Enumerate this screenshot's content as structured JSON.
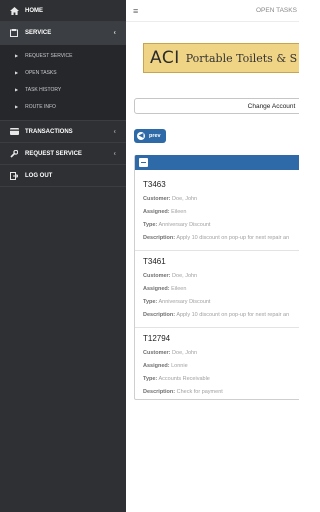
{
  "sidebar": {
    "items": [
      {
        "label": "HOME",
        "icon": "home-icon"
      },
      {
        "label": "SERVICE",
        "icon": "clipboard-icon",
        "active": true
      },
      {
        "label": "TRANSACTIONS",
        "icon": "card-icon"
      },
      {
        "label": "REQUEST SERVICE",
        "icon": "wrench-icon"
      },
      {
        "label": "LOG OUT",
        "icon": "logout-icon"
      }
    ],
    "service_sub": [
      {
        "label": "REQUEST SERVICE"
      },
      {
        "label": "OPEN TASKS"
      },
      {
        "label": "TASK HISTORY"
      },
      {
        "label": "ROUTE INFO"
      }
    ]
  },
  "topbar": {
    "title": "OPEN TASKS"
  },
  "logo": {
    "brand": "ACI",
    "tagline": "Portable Toilets & S"
  },
  "change_account": {
    "label": "Change Account"
  },
  "prev": {
    "label": "prev"
  },
  "field_labels": {
    "customer": "Customer:",
    "assigned": "Assigned:",
    "type": "Type:",
    "description": "Description:"
  },
  "tasks": [
    {
      "id": "T3463",
      "customer": "Doe, John",
      "assigned": "Eileen",
      "type": "Anniversary Discount",
      "description": "Apply 10 discount on pop-up for next repair an"
    },
    {
      "id": "T3461",
      "customer": "Doe, John",
      "assigned": "Eileen",
      "type": "Anniversary Discount",
      "description": "Apply 10 discount on pop-up for next repair an"
    },
    {
      "id": "T12794",
      "customer": "Doe, John",
      "assigned": "Lonnie",
      "type": "Accounts Receivable",
      "description": "Check for payment"
    }
  ],
  "colors": {
    "sidebar_bg": "#2e3033",
    "accent": "#2f6aa8",
    "logo_bg": "#f0d486"
  }
}
